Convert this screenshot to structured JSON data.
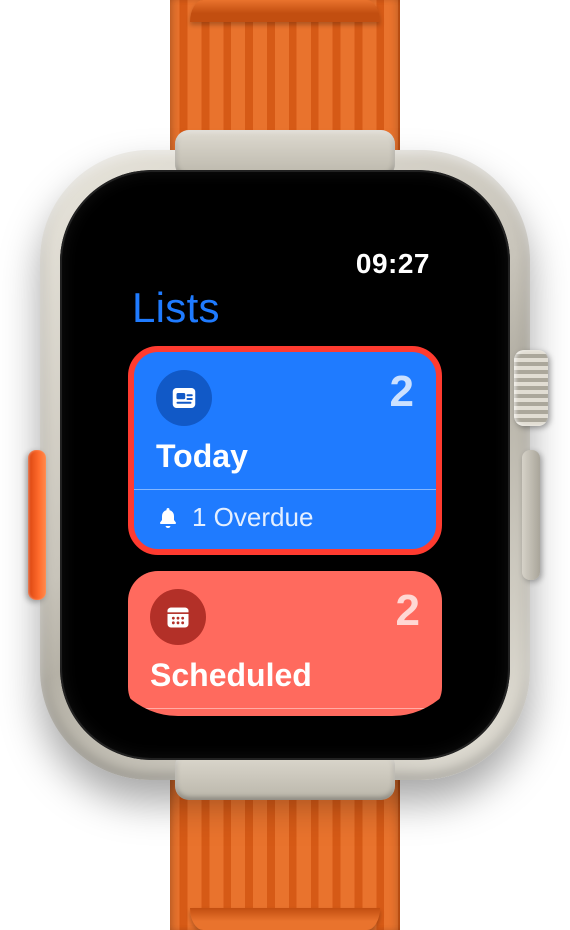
{
  "status": {
    "time": "09:27"
  },
  "header": {
    "title": "Lists"
  },
  "cards": [
    {
      "id": "today",
      "label": "Today",
      "count": "2",
      "overdue_label": "1 Overdue",
      "highlighted": true
    },
    {
      "id": "scheduled",
      "label": "Scheduled",
      "count": "2"
    }
  ],
  "colors": {
    "accent_blue": "#1f7bff",
    "highlight_red": "#ff3b30",
    "scheduled_bg": "#ff6a5e"
  }
}
